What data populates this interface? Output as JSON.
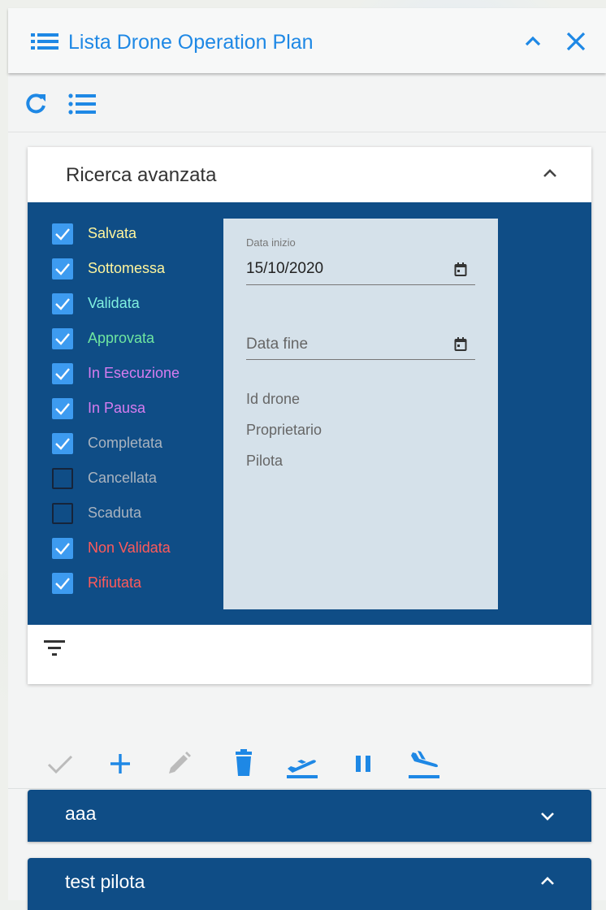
{
  "panel": {
    "title": "Lista Drone Operation Plan",
    "icons": {
      "list": "list-icon",
      "collapse": "chevron-up-icon",
      "close": "close-icon"
    }
  },
  "toolbar": {
    "icons": [
      "refresh-icon",
      "format-list-bulleted-icon"
    ]
  },
  "advanced_search": {
    "title": "Ricerca avanzata",
    "statuses": [
      {
        "label": "Salvata",
        "checked": true,
        "color": "#fff59d"
      },
      {
        "label": "Sottomessa",
        "checked": true,
        "color": "#fff59d"
      },
      {
        "label": "Validata",
        "checked": true,
        "color": "#80f0e0"
      },
      {
        "label": "Approvata",
        "checked": true,
        "color": "#6fe6a0"
      },
      {
        "label": "In Esecuzione",
        "checked": true,
        "color": "#d77cf0"
      },
      {
        "label": "In Pausa",
        "checked": true,
        "color": "#d77cf0"
      },
      {
        "label": "Completata",
        "checked": true,
        "color": "#a9b3bf"
      },
      {
        "label": "Cancellata",
        "checked": false,
        "color": "#a9b3bf"
      },
      {
        "label": "Scaduta",
        "checked": false,
        "color": "#a9b3bf"
      },
      {
        "label": "Non Validata",
        "checked": true,
        "color": "#ff5a5a"
      },
      {
        "label": "Rifiutata",
        "checked": true,
        "color": "#ff5a5a"
      }
    ],
    "start_date_label": "Data inizio",
    "start_date_value": "15/10/2020",
    "end_date_placeholder": "Data fine",
    "id_drone_label": "Id drone",
    "owner_label": "Proprietario",
    "pilot_label": "Pilota"
  },
  "actions": [
    "check-icon",
    "plus-icon",
    "pencil-icon",
    "delete-icon",
    "airplane-takeoff-icon",
    "pause-icon",
    "airplane-landing-icon"
  ],
  "plans": [
    {
      "name": "aaa",
      "expanded": false
    },
    {
      "name": "test pilota",
      "expanded": true
    }
  ],
  "colors": {
    "accent": "#1e88e5",
    "dark_blue": "#0f4d86",
    "checkbox": "#3d9bf0",
    "field_bg": "#d5e1ea"
  }
}
